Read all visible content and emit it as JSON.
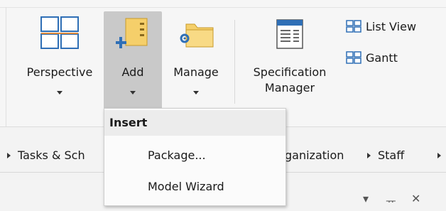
{
  "ribbon": {
    "perspective": {
      "label": "Perspective",
      "icon": "perspective-grid-icon"
    },
    "add": {
      "label": "Add",
      "icon": "add-element-icon"
    },
    "manage": {
      "label": "Manage",
      "icon": "manage-folder-icon"
    },
    "specification_manager": {
      "label_line1": "Specification",
      "label_line2": "Manager",
      "icon": "specification-document-icon"
    },
    "list_view": {
      "label": "List View",
      "icon": "list-view-icon"
    },
    "gantt": {
      "label": "Gantt",
      "icon": "gantt-icon"
    }
  },
  "menu": {
    "header": "Insert",
    "items": [
      {
        "label": "Package..."
      },
      {
        "label": "Model Wizard"
      }
    ]
  },
  "toolbar": {
    "tasks": "Tasks & Sch",
    "organization": "ganization",
    "staff": "Staff"
  },
  "panel": {
    "dropdown_glyph": "▾",
    "pin_glyph": "ᅲ",
    "close_glyph": "✕"
  },
  "colors": {
    "accent_blue": "#2f6fb6",
    "folder_yellow": "#f5cf6a",
    "highlight_gray": "#c9c9c9"
  }
}
